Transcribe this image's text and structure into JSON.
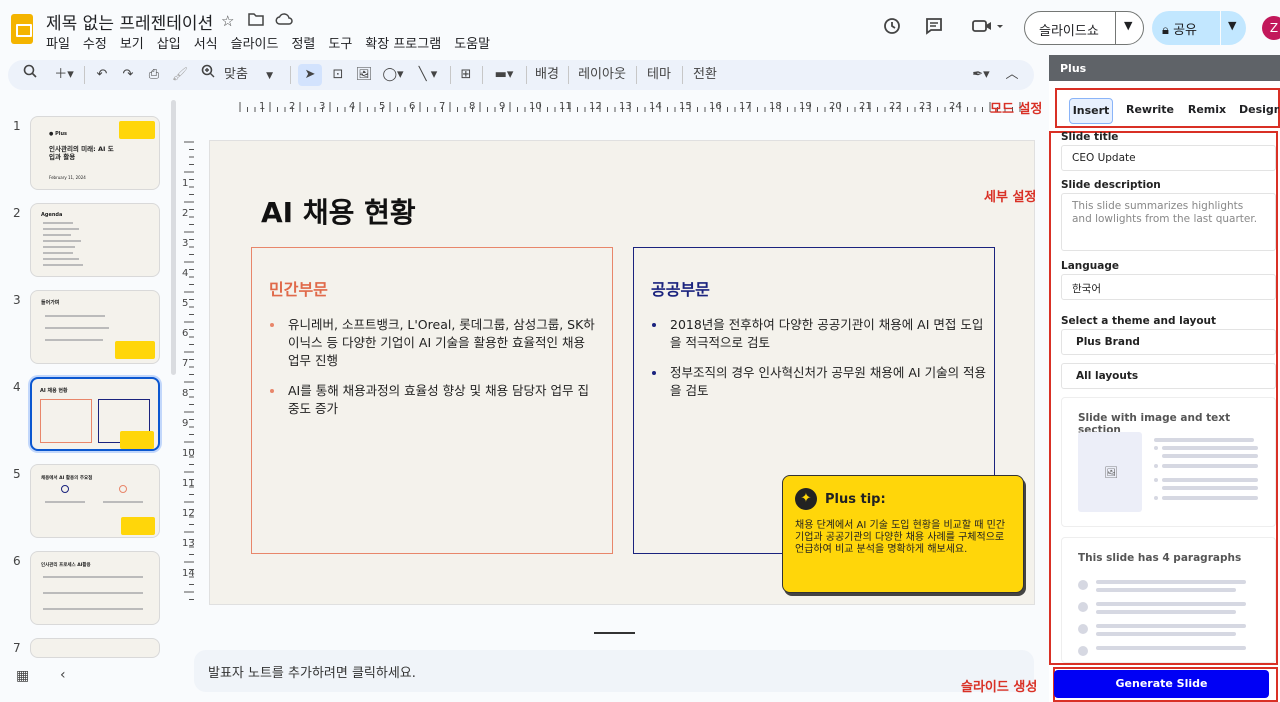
{
  "app": {
    "doc_title": "제목 없는 프레젠테이션",
    "menu": [
      "파일",
      "수정",
      "보기",
      "삽입",
      "서식",
      "슬라이드",
      "정렬",
      "도구",
      "확장 프로그램",
      "도움말"
    ],
    "slideshow_label": "슬라이드쇼",
    "share_label": "공유",
    "avatar_letter": "Z"
  },
  "toolbar": {
    "zoom_label": "맞춤",
    "background_label": "배경",
    "layout_label": "레이아웃",
    "theme_label": "테마",
    "transition_label": "전환"
  },
  "filmstrip": {
    "numbers": [
      "1",
      "2",
      "3",
      "4",
      "5",
      "6",
      "7"
    ],
    "thumb1_title": "인사관리의 미래: AI 도입과 활용",
    "thumb1_date": "February 11, 2024",
    "thumb2_title": "Agenda",
    "thumb3_title": "들어가며",
    "thumb4_title": "AI 채용 현황",
    "thumb5_title": "채용에서 AI 활용의 주요점",
    "thumb6_title": "인사관리 프로세스 AI활용"
  },
  "slide": {
    "title": "AI 채용 현황",
    "left": {
      "heading": "민간부문",
      "bullets": [
        "유니레버, 소프트뱅크, L'Oreal, 롯데그룹, 삼성그룹, SK하이닉스 등 다양한 기업이 AI 기술을 활용한 효율적인 채용 업무 진행",
        "AI를 통해 채용과정의 효율성 향상 및 채용 담당자 업무 집중도 증가"
      ]
    },
    "right": {
      "heading": "공공부문",
      "bullets": [
        "2018년을 전후하여 다양한 공공기관이 채용에 AI 면접 도입을 적극적으로 검토",
        "정부조직의 경우 인사혁신처가 공무원 채용에 AI 기술의 적용을 검토"
      ]
    },
    "tip": {
      "title": "Plus tip:",
      "body": "채용 단계에서 AI 기술 도입 현황을 비교할 때 민간 기업과 공공기관의 다양한 채용 사례를 구체적으로 언급하여 비교 분석을 명확하게 해보세요."
    }
  },
  "notes": {
    "placeholder": "발표자 노트를 추가하려면 클릭하세요."
  },
  "panel": {
    "title": "Plus",
    "tabs": [
      "Insert",
      "Rewrite",
      "Remix",
      "Design"
    ],
    "slide_title_label": "Slide title",
    "slide_title_value": "CEO Update",
    "slide_desc_label": "Slide description",
    "slide_desc_placeholder": "This slide summarizes highlights and lowlights from the last quarter.",
    "language_label": "Language",
    "language_value": "한국어",
    "theme_label": "Select a theme and layout",
    "theme_value": "Plus Brand",
    "layouts_value": "All layouts",
    "card1_title": "Slide with image and text section",
    "card2_title": "This slide has 4 paragraphs",
    "generate_label": "Generate Slide"
  },
  "annotations": {
    "mode": "모드 설정",
    "detail": "세부 설정",
    "generate": "슬라이드 생성"
  },
  "colors": {
    "accent_red": "#d93025",
    "generate_blue": "#0000f5",
    "tip_yellow": "#ffd60a",
    "left_border": "#e8866a",
    "right_border": "#1a237e"
  }
}
